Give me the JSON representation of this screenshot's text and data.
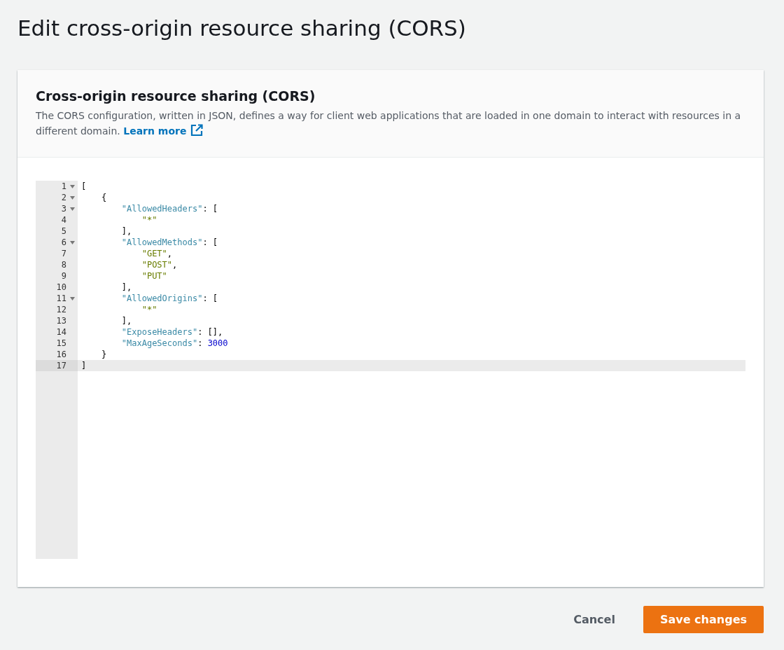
{
  "page_title": "Edit cross-origin resource sharing (CORS)",
  "panel": {
    "title": "Cross-origin resource sharing (CORS)",
    "description": "The CORS configuration, written in JSON, defines a way for client web applications that are loaded in one domain to interact with resources in a different domain.",
    "link": "Learn more"
  },
  "editor": {
    "lines": [
      {
        "number": "1",
        "foldable": true,
        "active": false,
        "tokens": [
          {
            "kind": "punct",
            "text": "["
          }
        ]
      },
      {
        "number": "2",
        "foldable": true,
        "active": false,
        "tokens": [
          {
            "kind": "punct",
            "text": "    {"
          }
        ]
      },
      {
        "number": "3",
        "foldable": true,
        "active": false,
        "tokens": [
          {
            "kind": "key",
            "text": "        \"AllowedHeaders\""
          },
          {
            "kind": "punct",
            "text": ": ["
          }
        ]
      },
      {
        "number": "4",
        "foldable": false,
        "active": false,
        "tokens": [
          {
            "kind": "string",
            "text": "            \"*\""
          }
        ]
      },
      {
        "number": "5",
        "foldable": false,
        "active": false,
        "tokens": [
          {
            "kind": "punct",
            "text": "        ],"
          }
        ]
      },
      {
        "number": "6",
        "foldable": true,
        "active": false,
        "tokens": [
          {
            "kind": "key",
            "text": "        \"AllowedMethods\""
          },
          {
            "kind": "punct",
            "text": ": ["
          }
        ]
      },
      {
        "number": "7",
        "foldable": false,
        "active": false,
        "tokens": [
          {
            "kind": "string",
            "text": "            \"GET\""
          },
          {
            "kind": "punct",
            "text": ","
          }
        ]
      },
      {
        "number": "8",
        "foldable": false,
        "active": false,
        "tokens": [
          {
            "kind": "string",
            "text": "            \"POST\""
          },
          {
            "kind": "punct",
            "text": ","
          }
        ]
      },
      {
        "number": "9",
        "foldable": false,
        "active": false,
        "tokens": [
          {
            "kind": "string",
            "text": "            \"PUT\""
          }
        ]
      },
      {
        "number": "10",
        "foldable": false,
        "active": false,
        "tokens": [
          {
            "kind": "punct",
            "text": "        ],"
          }
        ]
      },
      {
        "number": "11",
        "foldable": true,
        "active": false,
        "tokens": [
          {
            "kind": "key",
            "text": "        \"AllowedOrigins\""
          },
          {
            "kind": "punct",
            "text": ": ["
          }
        ]
      },
      {
        "number": "12",
        "foldable": false,
        "active": false,
        "tokens": [
          {
            "kind": "string",
            "text": "            \"*\""
          }
        ]
      },
      {
        "number": "13",
        "foldable": false,
        "active": false,
        "tokens": [
          {
            "kind": "punct",
            "text": "        ],"
          }
        ]
      },
      {
        "number": "14",
        "foldable": false,
        "active": false,
        "tokens": [
          {
            "kind": "key",
            "text": "        \"ExposeHeaders\""
          },
          {
            "kind": "punct",
            "text": ": [],"
          }
        ]
      },
      {
        "number": "15",
        "foldable": false,
        "active": false,
        "tokens": [
          {
            "kind": "key",
            "text": "        \"MaxAgeSeconds\""
          },
          {
            "kind": "punct",
            "text": ": "
          },
          {
            "kind": "number",
            "text": "3000"
          }
        ]
      },
      {
        "number": "16",
        "foldable": false,
        "active": false,
        "tokens": [
          {
            "kind": "punct",
            "text": "    }"
          }
        ]
      },
      {
        "number": "17",
        "foldable": false,
        "active": true,
        "tokens": [
          {
            "kind": "punct",
            "text": "]"
          }
        ]
      }
    ]
  },
  "buttons": [
    {
      "label": "Cancel",
      "kind": "link"
    },
    {
      "label": "Save changes",
      "kind": "primary"
    }
  ]
}
